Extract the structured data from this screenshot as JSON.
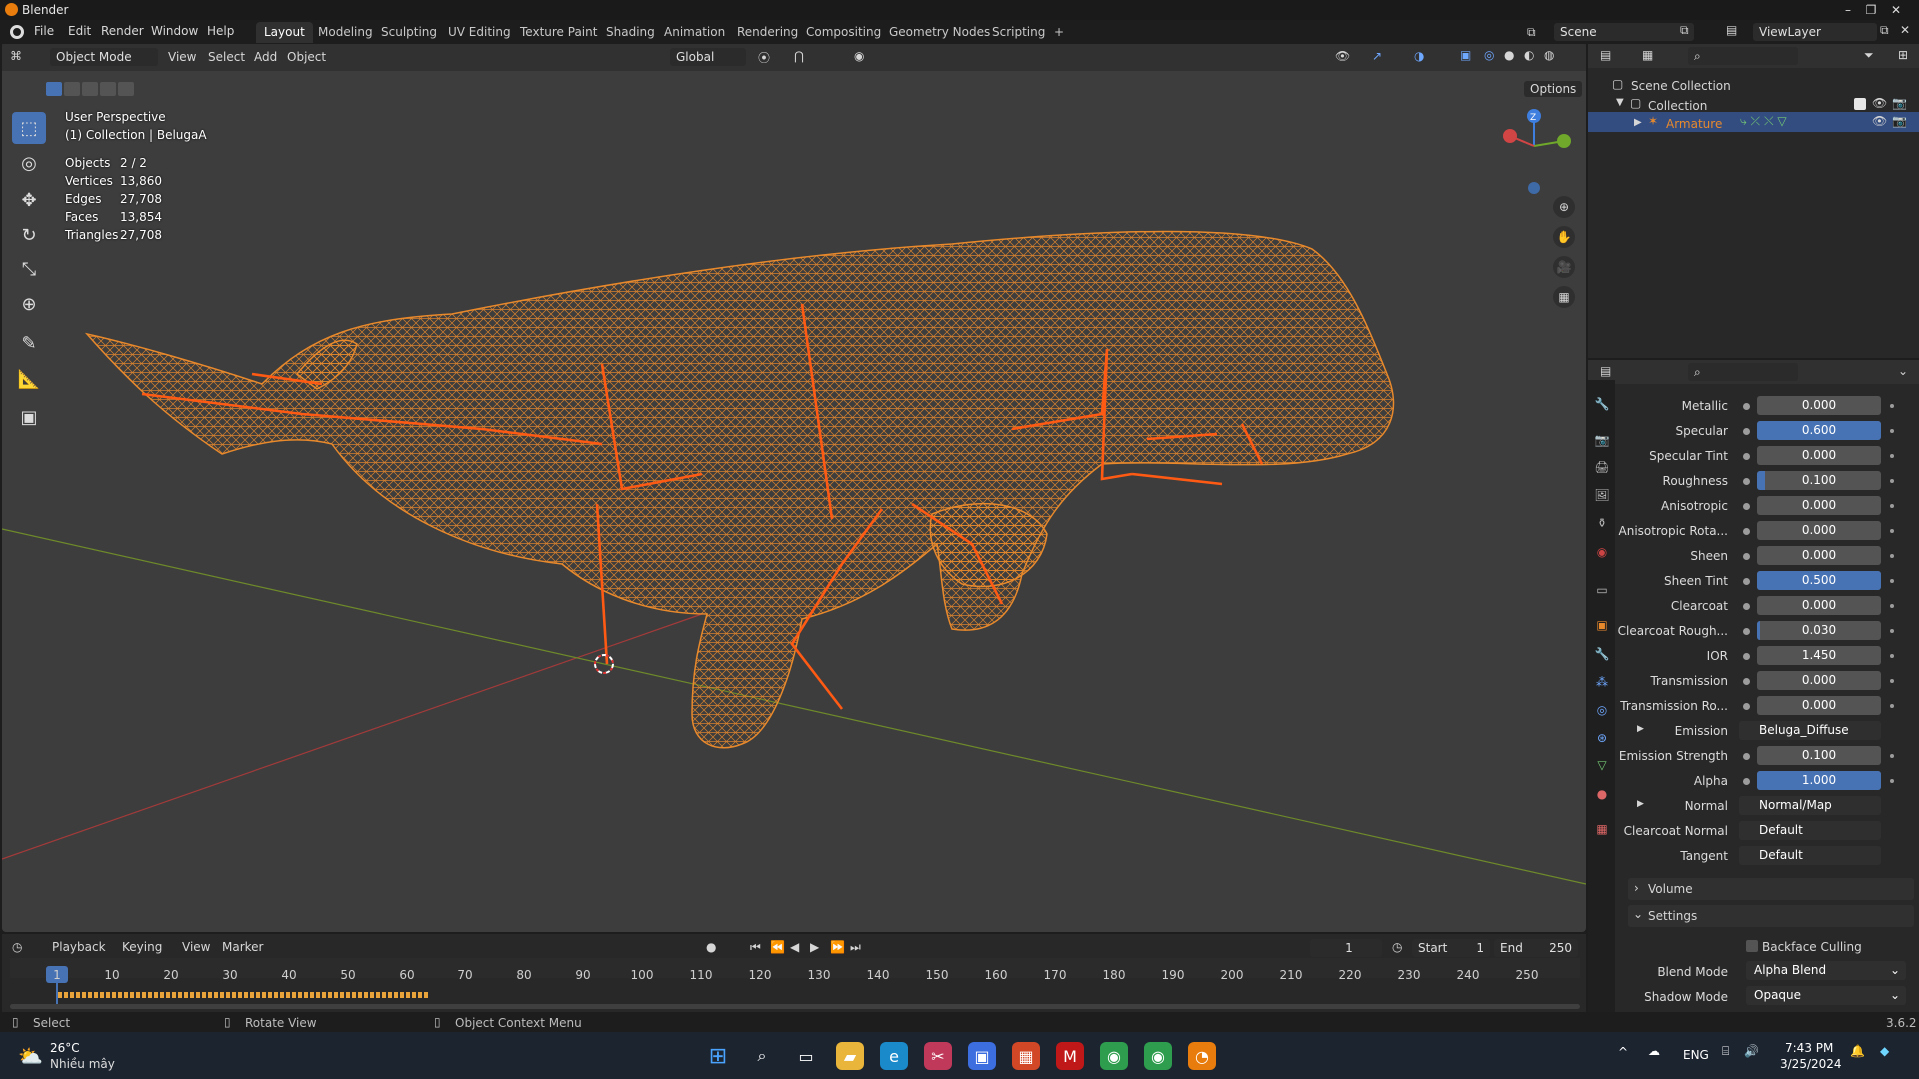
{
  "window": {
    "title": "Blender",
    "controls": [
      "–",
      "❐",
      "✕"
    ]
  },
  "menubar": {
    "menus": [
      "File",
      "Edit",
      "Render",
      "Window",
      "Help"
    ],
    "workspaces": [
      "Layout",
      "Modeling",
      "Sculpting",
      "UV Editing",
      "Texture Paint",
      "Shading",
      "Animation",
      "Rendering",
      "Compositing",
      "Geometry Nodes",
      "Scripting",
      "+"
    ],
    "active_workspace": "Layout",
    "scene": "Scene",
    "view_layer": "ViewLayer"
  },
  "viewport_header": {
    "mode": "Object Mode",
    "menus": [
      "View",
      "Select",
      "Add",
      "Object"
    ],
    "orientation": "Global",
    "options": "Options"
  },
  "viewport": {
    "perspective": "User Perspective",
    "collection": "(1) Collection | BelugaA",
    "stats": [
      {
        "label": "Objects",
        "value": "2 / 2"
      },
      {
        "label": "Vertices",
        "value": "13,860"
      },
      {
        "label": "Edges",
        "value": "27,708"
      },
      {
        "label": "Faces",
        "value": "13,854"
      },
      {
        "label": "Triangles",
        "value": "27,708"
      }
    ],
    "gizmo": {
      "z": "Z"
    },
    "colors": {
      "background": "#3d3d3d",
      "wire": "#e8892c",
      "bones": "#ff5a14",
      "x_axis": "#a33a3a",
      "y_axis": "#6e8a2a"
    }
  },
  "outliner": {
    "scene_collection": "Scene Collection",
    "collection": "Collection",
    "armature": "Armature"
  },
  "properties": {
    "rows": [
      {
        "label": "Metallic",
        "value": "0.000",
        "fill": 0
      },
      {
        "label": "Specular",
        "value": "0.600",
        "fill": 1
      },
      {
        "label": "Specular Tint",
        "value": "0.000",
        "fill": 0
      },
      {
        "label": "Roughness",
        "value": "0.100",
        "fill": 0.06
      },
      {
        "label": "Anisotropic",
        "value": "0.000",
        "fill": 0
      },
      {
        "label": "Anisotropic Rota...",
        "value": "0.000",
        "fill": 0
      },
      {
        "label": "Sheen",
        "value": "0.000",
        "fill": 0
      },
      {
        "label": "Sheen Tint",
        "value": "0.500",
        "fill": 1
      },
      {
        "label": "Clearcoat",
        "value": "0.000",
        "fill": 0
      },
      {
        "label": "Clearcoat Rough...",
        "value": "0.030",
        "fill": 0.02
      },
      {
        "label": "IOR",
        "value": "1.450",
        "fill": 0
      },
      {
        "label": "Transmission",
        "value": "0.000",
        "fill": 0
      },
      {
        "label": "Transmission Ro...",
        "value": "0.000",
        "fill": 0
      },
      {
        "label": "Emission",
        "value": "Beluga_Diffuse",
        "link": true,
        "dot": "#c7b13d",
        "expand": true
      },
      {
        "label": "Emission Strength",
        "value": "0.100",
        "fill": 0
      },
      {
        "label": "Alpha",
        "value": "1.000",
        "fill": 1
      },
      {
        "label": "Normal",
        "value": "Normal/Map",
        "link": true,
        "dot": "#6363c7",
        "expand": true
      },
      {
        "label": "Clearcoat Normal",
        "value": "Default",
        "link": true,
        "dot": "#6363c7"
      },
      {
        "label": "Tangent",
        "value": "Default",
        "link": true,
        "dot": "#6363c7"
      }
    ],
    "volume": "Volume",
    "settings": "Settings",
    "backface_culling": "Backface Culling",
    "blend_mode_label": "Blend Mode",
    "blend_mode": "Alpha Blend",
    "shadow_mode_label": "Shadow Mode",
    "shadow_mode": "Opaque",
    "accent": "#4772b3"
  },
  "timeline": {
    "menus": [
      "Playback",
      "Keying",
      "View",
      "Marker"
    ],
    "current_frame": "1",
    "start_label": "Start",
    "start": "1",
    "end_label": "End",
    "end": "250",
    "ruler": [
      "1",
      "10",
      "20",
      "30",
      "40",
      "50",
      "60",
      "70",
      "80",
      "90",
      "100",
      "110",
      "120",
      "130",
      "140",
      "150",
      "160",
      "170",
      "180",
      "190",
      "200",
      "210",
      "220",
      "230",
      "240",
      "250"
    ]
  },
  "statusbar": {
    "select": "Select",
    "rotate": "Rotate View",
    "context": "Object Context Menu",
    "version": "3.6.2"
  },
  "taskbar": {
    "weather_temp": "26°C",
    "weather_desc": "Nhiều mây",
    "lang": "ENG",
    "time": "7:43 PM",
    "date": "3/25/2024"
  }
}
